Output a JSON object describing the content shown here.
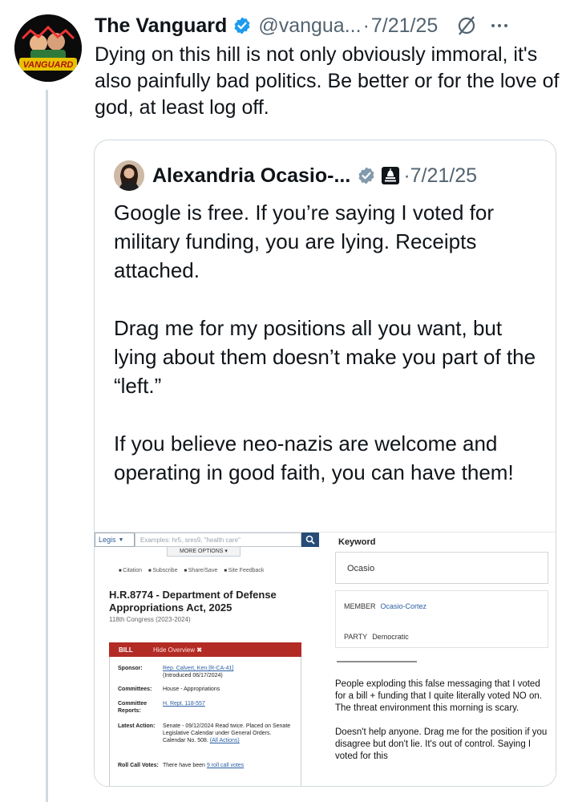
{
  "tweet": {
    "author_name": "The Vanguard",
    "handle": "@vangua...",
    "separator": "·",
    "date": "7/21/25",
    "avatar_text": "VANGUARD",
    "text": "Dying on this hill is not only obviously immoral, it's also painfully bad politics. Be better or for the love of god, at least log off."
  },
  "quote": {
    "author_name": "Alexandria Ocasio-...",
    "separator": "·",
    "date": "7/21/25",
    "paragraphs": [
      "Google is free. If you’re saying I voted for military funding, you are lying. Receipts attached.",
      "Drag me for my positions all you want, but lying about them doesn’t make you part of the “left.”",
      "If you believe neo-nazis are welcome and operating in good faith, you can have them!"
    ]
  },
  "attachment": {
    "left": {
      "search_dropdown": "Legis",
      "search_placeholder": "Examples: hr5, sres9, \"health care\"",
      "more_options": "MORE OPTIONS",
      "tools": [
        "Citation",
        "Subscribe",
        "Share/Save",
        "Site Feedback"
      ],
      "bill_title": "H.R.8774 - Department of Defense Appropriations Act, 2025",
      "congress": "118th Congress (2023-2024)",
      "bill_tag": "BILL",
      "hide_overview": "Hide Overview",
      "rows": [
        {
          "label": "Sponsor:",
          "value": "Rep. Calvert, Ken [R-CA-41]",
          "extra": "(Introduced 06/17/2024)"
        },
        {
          "label": "Committees:",
          "value": "House - Appropriations"
        },
        {
          "label": "Committee Reports:",
          "value": "H. Rept. 118-557"
        },
        {
          "label": "Latest Action:",
          "value": "Senate - 09/12/2024 Read twice. Placed on Senate Legislative Calendar under General Orders. Calendar No. 508.",
          "link": "(All Actions)"
        },
        {
          "label": "Roll Call Votes:",
          "value": "There have been",
          "link": "9 roll call votes"
        }
      ]
    },
    "right": {
      "keyword_label": "Keyword",
      "keyword_value": "Ocasio",
      "member_label": "MEMBER",
      "member_value": "Ocasio-Cortez",
      "party_label": "PARTY",
      "party_value": "Democratic",
      "post_paragraphs": [
        "People exploding this false messaging that I voted for a bill + funding that I quite literally voted NO on. The threat environment this morning is scary.",
        "Doesn't help anyone. Drag me for the position if you disagree but don't lie. It's out of control. Saying I voted for this"
      ]
    }
  },
  "colors": {
    "verified_blue": "#1d9bf0",
    "gray_badge": "#829aab",
    "secondary_text": "#536471",
    "congress_red": "#b32b25",
    "link_blue": "#2a5ea4"
  },
  "icons": {
    "verified": "verified-badge-icon",
    "edit": "edited-icon",
    "more": "more-options-icon",
    "gov": "government-badge-icon"
  }
}
